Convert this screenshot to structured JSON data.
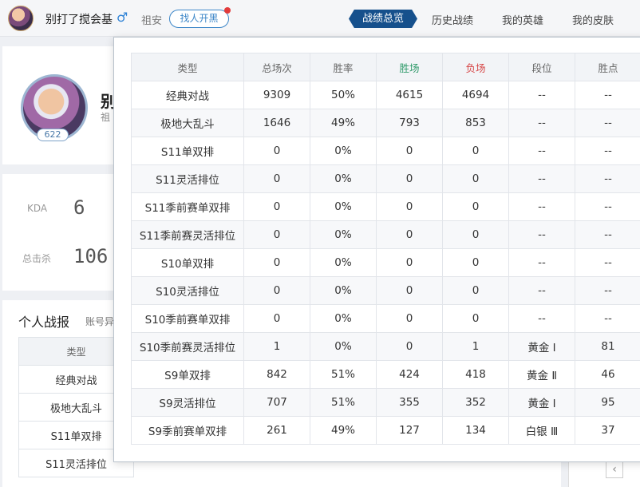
{
  "topbar": {
    "username": "别打了搅会基",
    "gender_icon": "male-icon",
    "region": "祖安",
    "find_button": "找人开黑",
    "tabs": [
      "战绩总览",
      "历史战绩",
      "我的英雄",
      "我的皮肤"
    ],
    "active_tab": "战绩总览"
  },
  "profile": {
    "name": "别",
    "region": "祖",
    "level": "622"
  },
  "stats": [
    {
      "label": "KDA",
      "value": "6"
    },
    {
      "label": "总击杀",
      "value": "106"
    }
  ],
  "section": {
    "title": "个人战报",
    "subtitle": "账号异"
  },
  "bg_table": {
    "header": "类型",
    "rows": [
      "经典对战",
      "极地大乱斗",
      "S11单双排",
      "S11灵活排位"
    ]
  },
  "pager": {
    "prev": "‹"
  },
  "popup": {
    "columns": [
      "类型",
      "总场次",
      "胜率",
      "胜场",
      "负场",
      "段位",
      "胜点"
    ],
    "rows": [
      [
        "经典对战",
        "9309",
        "50%",
        "4615",
        "4694",
        "--",
        "--"
      ],
      [
        "极地大乱斗",
        "1646",
        "49%",
        "793",
        "853",
        "--",
        "--"
      ],
      [
        "S11单双排",
        "0",
        "0%",
        "0",
        "0",
        "--",
        "--"
      ],
      [
        "S11灵活排位",
        "0",
        "0%",
        "0",
        "0",
        "--",
        "--"
      ],
      [
        "S11季前赛单双排",
        "0",
        "0%",
        "0",
        "0",
        "--",
        "--"
      ],
      [
        "S11季前赛灵活排位",
        "0",
        "0%",
        "0",
        "0",
        "--",
        "--"
      ],
      [
        "S10单双排",
        "0",
        "0%",
        "0",
        "0",
        "--",
        "--"
      ],
      [
        "S10灵活排位",
        "0",
        "0%",
        "0",
        "0",
        "--",
        "--"
      ],
      [
        "S10季前赛单双排",
        "0",
        "0%",
        "0",
        "0",
        "--",
        "--"
      ],
      [
        "S10季前赛灵活排位",
        "1",
        "0%",
        "0",
        "1",
        "黄金 Ⅰ",
        "81"
      ],
      [
        "S9单双排",
        "842",
        "51%",
        "424",
        "418",
        "黄金 Ⅱ",
        "46"
      ],
      [
        "S9灵活排位",
        "707",
        "51%",
        "355",
        "352",
        "黄金 Ⅰ",
        "95"
      ],
      [
        "S9季前赛单双排",
        "261",
        "49%",
        "127",
        "134",
        "白银 Ⅲ",
        "37"
      ]
    ]
  }
}
